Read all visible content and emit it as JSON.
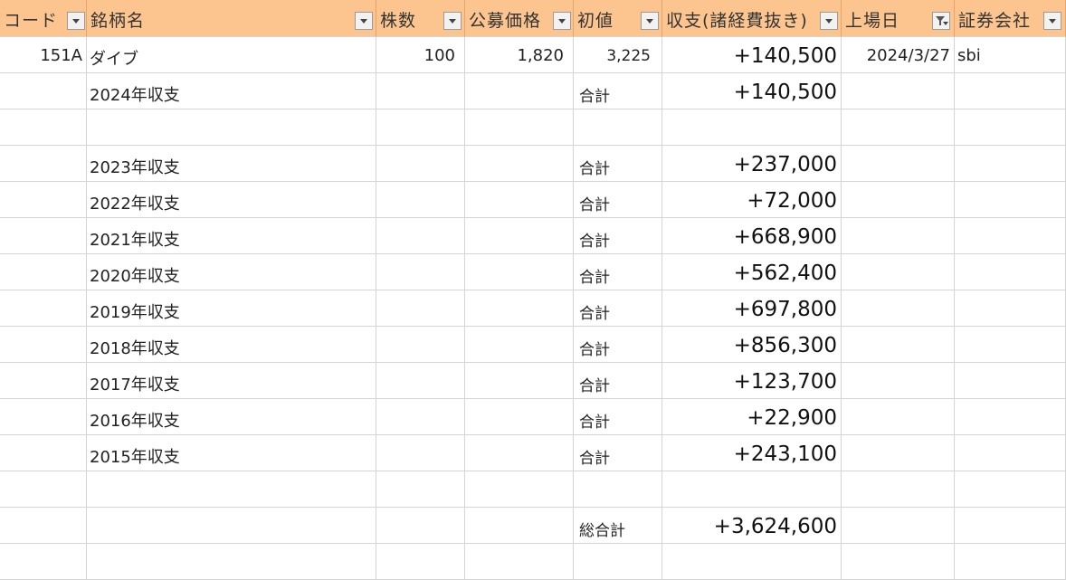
{
  "headers": [
    {
      "label": "コード",
      "filter": "dropdown"
    },
    {
      "label": "銘柄名",
      "filter": "dropdown"
    },
    {
      "label": "株数",
      "filter": "dropdown"
    },
    {
      "label": "公募価格",
      "filter": "dropdown"
    },
    {
      "label": "初値",
      "filter": "dropdown"
    },
    {
      "label": "収支(諸経費抜き)",
      "filter": "dropdown"
    },
    {
      "label": "上場日",
      "filter": "filter-active"
    },
    {
      "label": "証券会社",
      "filter": "dropdown"
    }
  ],
  "record": {
    "code": "151A",
    "name": "ダイブ",
    "shares": "100",
    "offer_price": "1,820",
    "first_price": "3,225",
    "profit": "+140,500",
    "listing_date": "2024/3/27",
    "broker": "sbi"
  },
  "summary_label": "合計",
  "yearly": [
    {
      "label": "2024年収支",
      "total_label": "合計",
      "amount": "+140,500"
    },
    {
      "label": "2023年収支",
      "total_label": "合計",
      "amount": "+237,000"
    },
    {
      "label": "2022年収支",
      "total_label": "合計",
      "amount": "+72,000"
    },
    {
      "label": "2021年収支",
      "total_label": "合計",
      "amount": "+668,900"
    },
    {
      "label": "2020年収支",
      "total_label": "合計",
      "amount": "+562,400"
    },
    {
      "label": "2019年収支",
      "total_label": "合計",
      "amount": "+697,800"
    },
    {
      "label": "2018年収支",
      "total_label": "合計",
      "amount": "+856,300"
    },
    {
      "label": "2017年収支",
      "total_label": "合計",
      "amount": "+123,700"
    },
    {
      "label": "2016年収支",
      "total_label": "合計",
      "amount": "+22,900"
    },
    {
      "label": "2015年収支",
      "total_label": "合計",
      "amount": "+243,100"
    }
  ],
  "grand_total": {
    "label": "総合計",
    "amount": "+3,624,600"
  },
  "colors": {
    "header_bg": "#FCC58F",
    "gridline": "#D4D4D4"
  }
}
